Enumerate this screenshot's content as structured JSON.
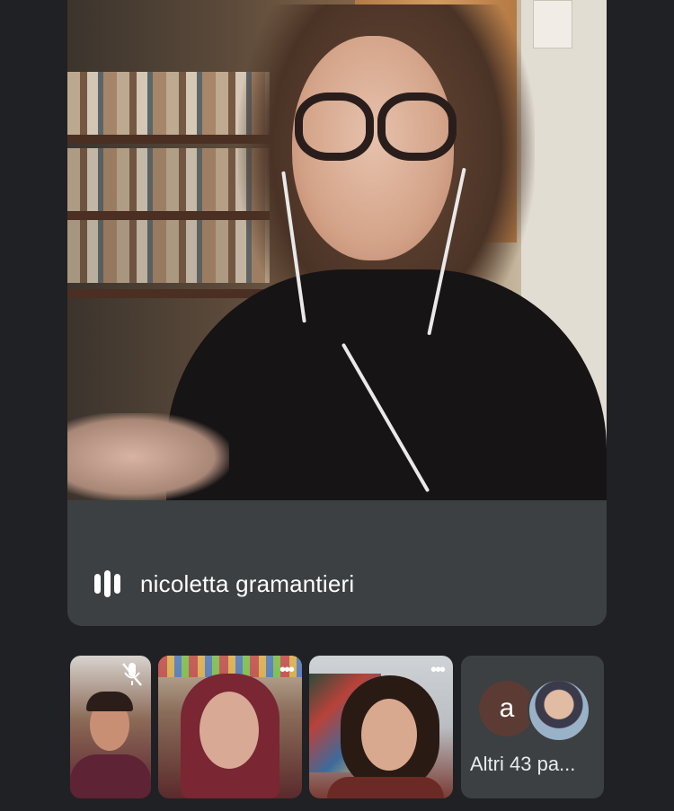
{
  "main_speaker": {
    "name": "nicoletta gramantieri",
    "audio_indicator": "audio-level-icon"
  },
  "thumbnails": [
    {
      "id": "participant-1",
      "icons": [
        "mic-off-icon"
      ]
    },
    {
      "id": "participant-2",
      "icons": [
        "more-options-icon"
      ]
    },
    {
      "id": "participant-3",
      "icons": [
        "more-options-icon"
      ]
    }
  ],
  "others_tile": {
    "avatar_initial": "a",
    "label": "Altri 43 pa..."
  },
  "colors": {
    "background": "#202124",
    "tile": "#3c4043",
    "text": "#ffffff"
  }
}
